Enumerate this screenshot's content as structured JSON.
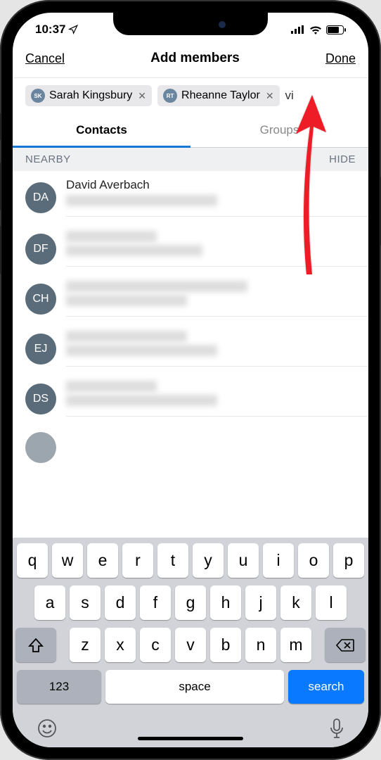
{
  "status": {
    "time": "10:37"
  },
  "nav": {
    "cancel": "Cancel",
    "title": "Add members",
    "done": "Done"
  },
  "chips": [
    {
      "initials": "SK",
      "name": "Sarah Kingsbury"
    },
    {
      "initials": "RT",
      "name": "Rheanne Taylor"
    }
  ],
  "chips_extra": "vi",
  "tabs": {
    "contacts": "Contacts",
    "groups": "Groups"
  },
  "section": {
    "title": "NEARBY",
    "action": "HIDE"
  },
  "contacts": [
    {
      "initials": "DA",
      "name": "David Averbach"
    },
    {
      "initials": "DF",
      "name": ""
    },
    {
      "initials": "CH",
      "name": ""
    },
    {
      "initials": "EJ",
      "name": ""
    },
    {
      "initials": "DS",
      "name": ""
    }
  ],
  "keyboard": {
    "row1": [
      "q",
      "w",
      "e",
      "r",
      "t",
      "y",
      "u",
      "i",
      "o",
      "p"
    ],
    "row2": [
      "a",
      "s",
      "d",
      "f",
      "g",
      "h",
      "j",
      "k",
      "l"
    ],
    "row3": [
      "z",
      "x",
      "c",
      "v",
      "b",
      "n",
      "m"
    ],
    "numeric": "123",
    "space": "space",
    "action": "search"
  }
}
